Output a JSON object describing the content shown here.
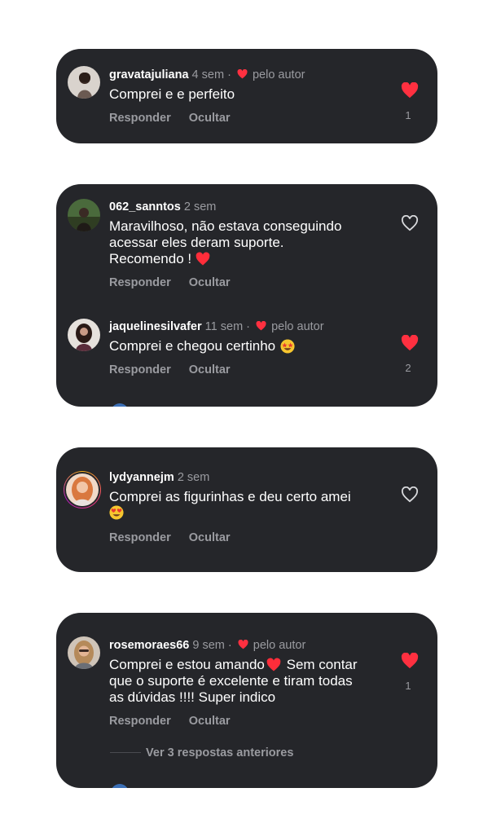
{
  "common": {
    "reply_label": "Responder",
    "hide_label": "Ocultar",
    "by_author": "pelo autor"
  },
  "comments": [
    {
      "user": "gravatajuliana",
      "time": "4 sem",
      "text": "Comprei e e perfeito",
      "likes": "1"
    },
    {
      "user": "062_sanntos",
      "time": "2 sem",
      "text_lines": [
        "Maravilhoso, não estava conseguindo",
        "acessar eles deram suporte.",
        "Recomendo !"
      ]
    },
    {
      "user": "jaquelinesilvafer",
      "time": "11 sem",
      "text": "Comprei e chegou certinho",
      "likes": "2"
    },
    {
      "user": "lydyannejm",
      "time": "2 sem",
      "text_lines": [
        "Comprei as figurinhas e deu certo amei"
      ]
    },
    {
      "user": "rosemoraes66",
      "time": "9 sem",
      "text_lines": [
        "Comprei e estou amando",
        "que o suporte é excelente e tiram todas",
        "as dúvidas !!!! Super indico"
      ],
      "text_line1_tail": " Sem contar",
      "likes": "1",
      "more_replies": "Ver 3 respostas anteriores"
    }
  ],
  "colors": {
    "card_bg": "#25262a",
    "like_red": "#ff3040",
    "muted": "#9a9ba0"
  },
  "icons": [
    "heart-filled-icon",
    "heart-outline-icon",
    "red-heart-emoji",
    "star-struck-emoji",
    "heart-eyes-emoji"
  ]
}
